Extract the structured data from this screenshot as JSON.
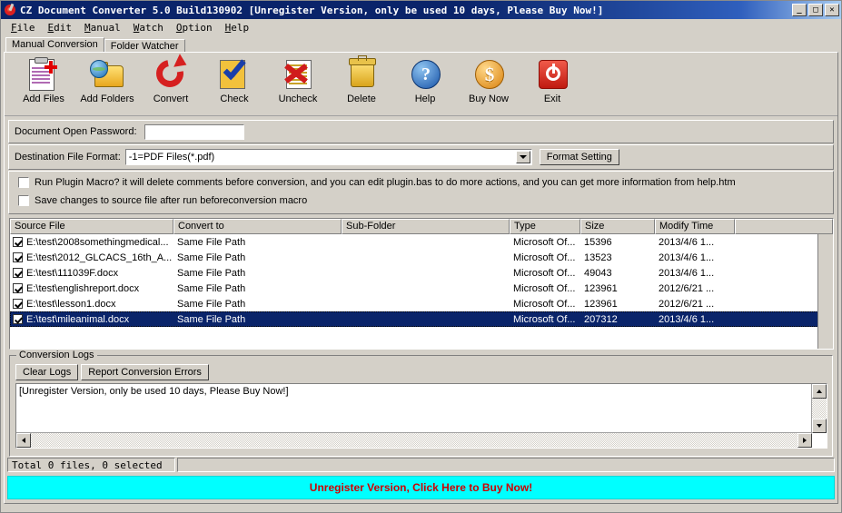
{
  "window": {
    "title": "CZ Document Converter 5.0 Build130902 [Unregister Version, only be used 10 days, Please Buy Now!]",
    "minimize_label": "_",
    "maximize_label": "□",
    "close_label": "✕"
  },
  "menu": [
    {
      "label": "File",
      "accel": "F"
    },
    {
      "label": "Edit",
      "accel": "E"
    },
    {
      "label": "Manual",
      "accel": "M"
    },
    {
      "label": "Watch",
      "accel": "W"
    },
    {
      "label": "Option",
      "accel": "O"
    },
    {
      "label": "Help",
      "accel": "H"
    }
  ],
  "tabs": [
    {
      "label": "Manual Conversion",
      "active": true
    },
    {
      "label": "Folder Watcher",
      "active": false
    }
  ],
  "toolbar": [
    {
      "label": "Add Files",
      "icon": "add-files-icon"
    },
    {
      "label": "Add Folders",
      "icon": "add-folders-icon"
    },
    {
      "label": "Convert",
      "icon": "convert-icon"
    },
    {
      "label": "Check",
      "icon": "check-icon"
    },
    {
      "label": "Uncheck",
      "icon": "uncheck-icon"
    },
    {
      "label": "Delete",
      "icon": "delete-icon"
    },
    {
      "label": "Help",
      "icon": "help-icon"
    },
    {
      "label": "Buy Now",
      "icon": "buy-now-icon"
    },
    {
      "label": "Exit",
      "icon": "exit-icon"
    }
  ],
  "form": {
    "password_label": "Document Open Password:",
    "password_value": "",
    "password_placeholder": "",
    "format_label": "Destination File Format:",
    "format_value": "-1=PDF Files(*.pdf)",
    "format_setting_label": "Format Setting",
    "plugin_macro_label": "Run Plugin Macro? it will delete comments before conversion, and you can  edit plugin.bas to do more actions, and you can get more information from help.htm",
    "plugin_macro_checked": false,
    "save_changes_label": "Save changes to source file after run beforeconversion macro",
    "save_changes_checked": false
  },
  "filelist": {
    "columns": [
      "Source File",
      "Convert to",
      "Sub-Folder",
      "Type",
      "Size",
      "Modify Time",
      ""
    ],
    "rows": [
      {
        "checked": true,
        "source": "E:\\test\\2008somethingmedical...",
        "convert_to": "Same File Path",
        "subfolder": "",
        "type": "Microsoft Of...",
        "size": "15396",
        "modified": "2013/4/6  1...",
        "selected": false
      },
      {
        "checked": true,
        "source": "E:\\test\\2012_GLCACS_16th_A...",
        "convert_to": "Same File Path",
        "subfolder": "",
        "type": "Microsoft Of...",
        "size": "13523",
        "modified": "2013/4/6  1...",
        "selected": false
      },
      {
        "checked": true,
        "source": "E:\\test\\111039F.docx",
        "convert_to": "Same File Path",
        "subfolder": "",
        "type": "Microsoft Of...",
        "size": "49043",
        "modified": "2013/4/6  1...",
        "selected": false
      },
      {
        "checked": true,
        "source": "E:\\test\\englishreport.docx",
        "convert_to": "Same File Path",
        "subfolder": "",
        "type": "Microsoft Of...",
        "size": "123961",
        "modified": "2012/6/21  ...",
        "selected": false
      },
      {
        "checked": true,
        "source": "E:\\test\\lesson1.docx",
        "convert_to": "Same File Path",
        "subfolder": "",
        "type": "Microsoft Of...",
        "size": "123961",
        "modified": "2012/6/21  ...",
        "selected": false
      },
      {
        "checked": true,
        "source": "E:\\test\\mileanimal.docx",
        "convert_to": "Same File Path",
        "subfolder": "",
        "type": "Microsoft Of...",
        "size": "207312",
        "modified": "2013/4/6  1...",
        "selected": true
      }
    ]
  },
  "logs": {
    "legend": "Conversion Logs",
    "clear_label": "Clear Logs",
    "report_label": "Report Conversion Errors",
    "text": "[Unregister Version, only be used 10 days, Please Buy Now!]"
  },
  "status": {
    "total_text": "Total 0 files, 0 selected",
    "secondary_text": ""
  },
  "banner": {
    "text": "Unregister Version, Click Here to Buy Now!",
    "background": "#00ffff",
    "color": "#d00000"
  }
}
